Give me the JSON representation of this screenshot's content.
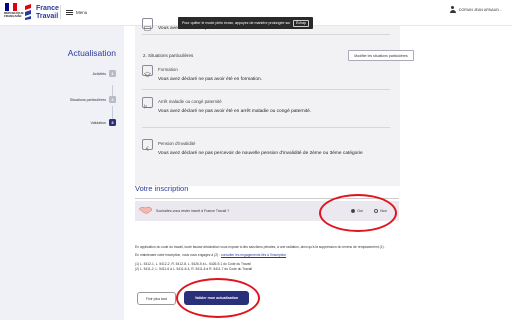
{
  "header": {
    "republic_text": "RÉPUBLIQUE FRANÇAISE",
    "brand_line1": "France",
    "brand_line2": "Travail",
    "menu_label": "Menu",
    "user_name": "DORIAN JEAN ARNAUD..."
  },
  "fullscreen_tip": {
    "message": "Pour quitter le mode plein écran, appuyez de manière prolongée sur",
    "key": "Échap"
  },
  "sidebar": {
    "title": "Actualisation",
    "steps": [
      {
        "label": "Activités",
        "num": "1"
      },
      {
        "label": "Situations particulières",
        "num": "2"
      },
      {
        "label": "Validation",
        "num": "3"
      }
    ]
  },
  "situations": {
    "top_desc": "Vous avez déclaré ne pas avoir eu d'arrêt de travail.",
    "section_title": "2. Situations particulières",
    "modify_label": "Modifier les situations particulières",
    "items": [
      {
        "title": "Formation",
        "desc": "Vous avez déclaré ne pas avoir été en formation.",
        "icon": "graduation-cap-icon"
      },
      {
        "title": "Arrêt maladie ou congé paternité",
        "desc": "Vous avez déclaré ne pas avoir été en arrêt maladie ou congé paternité.",
        "icon": "bed-icon"
      },
      {
        "title": "Pension d'invalidité",
        "desc": "Vous avez déclaré ne pas percevoir de nouvelle pension d'invalidité de 2ème ou 3ème catégorie",
        "icon": "euro-icon"
      }
    ]
  },
  "inscription": {
    "title": "Votre inscription",
    "question": "Souhaitez-vous rester inscrit à France Travail ?",
    "option_yes": "Oui",
    "option_no": "Non",
    "selected": "Oui"
  },
  "legal": {
    "line1": "En application du code du travail, toute fausse déclaration vous expose à des sanctions pénales, à une radiation, ainsi qu'à la suppression du revenu de remplacement (1).",
    "line2_prefix": "En maintenant votre inscription, vous vous engagez à (2) :",
    "line2_link": "consulter les engagements liés à l'inscription",
    "ref1": "(1) L. 5412-1, L. 5412-2, R. 5412-8, L. 5426-5 à L. 5426-9-1 du Code du Travail",
    "ref2": "(2) L. 5411-2, L. 5411-6 à L. 5411-6-4, R. 5411-6 à R. 5411-7 du Code du Travail"
  },
  "actions": {
    "later_label": "Finir plus tard",
    "submit_label": "Valider mon actualisation"
  },
  "colors": {
    "brand": "#2a2f7a",
    "annotation": "#e0141e",
    "sidebar_bg": "#f0f1f6"
  }
}
